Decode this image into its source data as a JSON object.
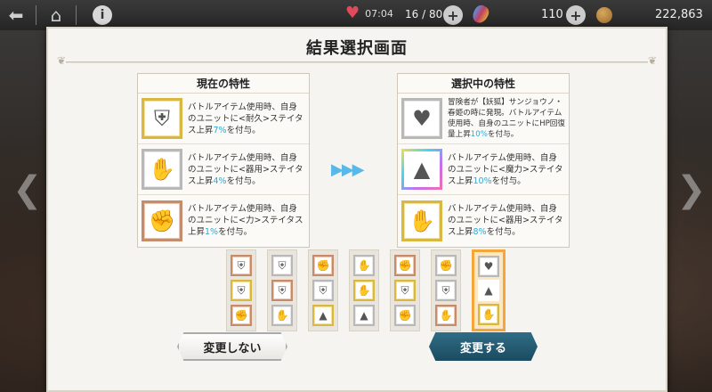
{
  "header": {
    "stamina_time": "07:04",
    "stamina_count": "16 / 80",
    "gem_count": "110",
    "coin_count": "222,863"
  },
  "dialog": {
    "title": "結果選択画面",
    "current": {
      "title": "現在の特性",
      "items": [
        {
          "icon": "shield-icon",
          "pre": "バトルアイテム使用時、自身のユニットに<耐久>ステイタス上昇",
          "value": "7%",
          "post": "を付与。"
        },
        {
          "icon": "hand-icon",
          "pre": "バトルアイテム使用時、自身のユニットに<器用>ステイタス上昇",
          "value": "4%",
          "post": "を付与。"
        },
        {
          "icon": "fist-icon",
          "pre": "バトルアイテム使用時、自身のユニットに<力>ステイタス上昇",
          "value": "1%",
          "post": "を付与。"
        }
      ]
    },
    "selected": {
      "title": "選択中の特性",
      "items": [
        {
          "icon": "hearts-icon",
          "pre": "冒険者が【妖狐】サンジョウノ・春姫の時に発現。バトルアイテム使用時、自身のユニットにHP回復量上昇",
          "value": "10%",
          "post": "を付与。"
        },
        {
          "icon": "wizard-hat-icon",
          "pre": "バトルアイテム使用時、自身のユニットに<魔力>ステイタス上昇",
          "value": "10%",
          "post": "を付与。"
        },
        {
          "icon": "hand-icon",
          "pre": "バトルアイテム使用時、自身のユニットに<器用>ステイタス上昇",
          "value": "8%",
          "post": "を付与。"
        }
      ]
    },
    "options": [
      {
        "selected": false,
        "slots": [
          [
            "bronze",
            "shield-icon"
          ],
          [
            "gold",
            "shield-icon"
          ],
          [
            "bronze",
            "fist-icon"
          ]
        ]
      },
      {
        "selected": false,
        "slots": [
          [
            "silver",
            "shield-icon"
          ],
          [
            "bronze",
            "shield-icon"
          ],
          [
            "silver",
            "hand-icon"
          ]
        ]
      },
      {
        "selected": false,
        "slots": [
          [
            "bronze",
            "fist-icon"
          ],
          [
            "silver",
            "shield-icon"
          ],
          [
            "gold",
            "wizard-hat-icon"
          ]
        ]
      },
      {
        "selected": false,
        "slots": [
          [
            "silver",
            "hand-icon"
          ],
          [
            "gold",
            "hand-icon"
          ],
          [
            "silver",
            "wizard-hat-icon"
          ]
        ]
      },
      {
        "selected": false,
        "slots": [
          [
            "bronze",
            "fist-icon"
          ],
          [
            "gold",
            "shield-icon"
          ],
          [
            "silver",
            "fist-icon"
          ]
        ]
      },
      {
        "selected": false,
        "slots": [
          [
            "silver",
            "fist-icon"
          ],
          [
            "silver",
            "shield-icon"
          ],
          [
            "bronze",
            "hand-icon"
          ]
        ]
      },
      {
        "selected": true,
        "slots": [
          [
            "silver",
            "hearts-icon"
          ],
          [
            "rainbow",
            "wizard-hat-icon"
          ],
          [
            "gold",
            "hand-icon"
          ]
        ]
      }
    ],
    "cancel_label": "変更しない",
    "confirm_label": "変更する"
  }
}
